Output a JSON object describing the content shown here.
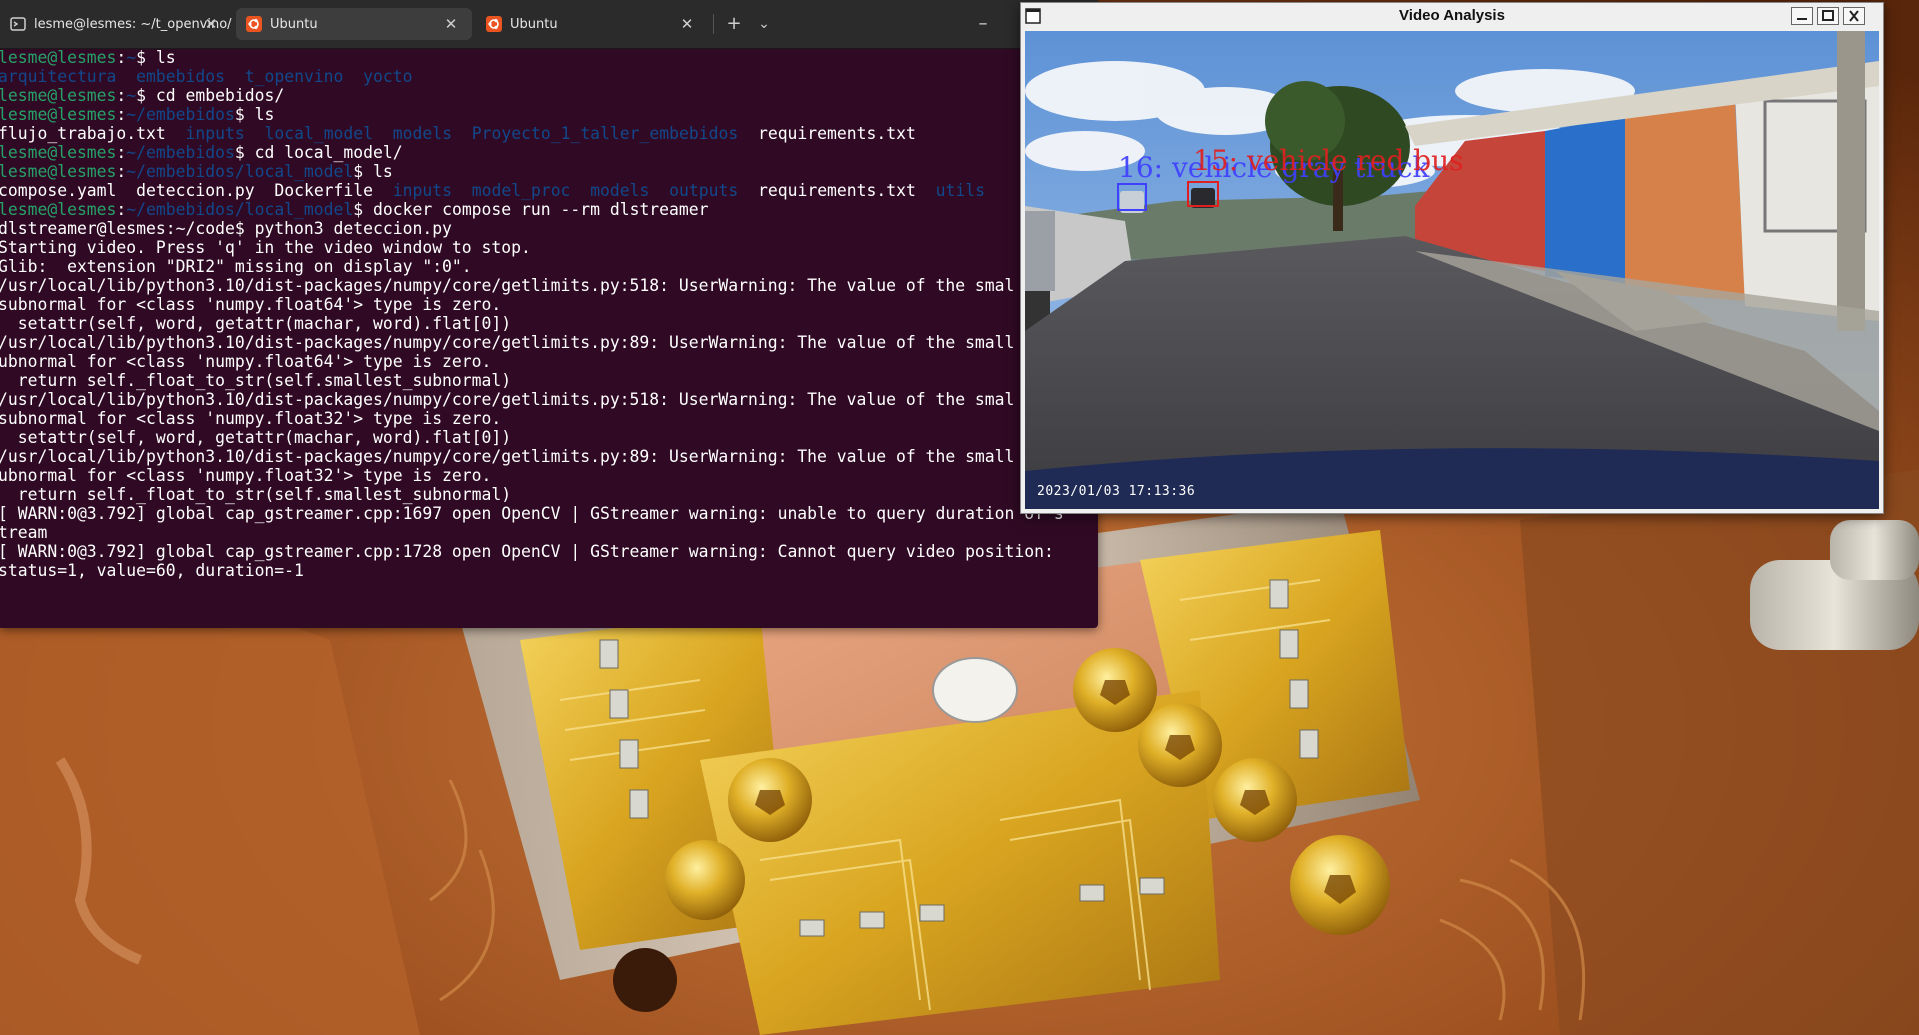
{
  "terminal": {
    "tabs": [
      {
        "title": "lesme@lesmes: ~/t_openvino/",
        "icon": "terminal-icon",
        "active": false
      },
      {
        "title": "Ubuntu",
        "icon": "ubuntu-icon",
        "active": true
      },
      {
        "title": "Ubuntu",
        "icon": "ubuntu-icon",
        "active": false
      }
    ],
    "new_tab_label": "+",
    "tab_menu_label": "⌄",
    "minimize_label": "–",
    "colors": {
      "background": "#300a24",
      "prompt_user": "#26a269",
      "prompt_path": "#12488b"
    },
    "lines": {
      "l1": {
        "user": "lesme@lesmes",
        "path": "~",
        "cmd": "$ ls"
      },
      "l2": {
        "dirs": [
          "arquitectura",
          "embebidos",
          "t_openvino",
          "yocto"
        ]
      },
      "l3": {
        "user": "lesme@lesmes",
        "path": "~",
        "cmd": "$ cd embebidos/"
      },
      "l4": {
        "user": "lesme@lesmes",
        "path": "~/embebidos",
        "cmd": "$ ls"
      },
      "l5": {
        "file1": "flujo_trabajo.txt",
        "dirs": [
          "inputs",
          "local_model",
          "models",
          "Proyecto_1_taller_embebidos"
        ],
        "file2": "requirements.txt"
      },
      "l6": {
        "user": "lesme@lesmes",
        "path": "~/embebidos",
        "cmd": "$ cd local_model/"
      },
      "l7": {
        "user": "lesme@lesmes",
        "path": "~/embebidos/local_model",
        "cmd": "$ ls"
      },
      "l8": {
        "files1": [
          "compose.yaml",
          "deteccion.py",
          "Dockerfile"
        ],
        "dirs": [
          "inputs",
          "model_proc",
          "models",
          "outputs"
        ],
        "file2": "requirements.txt",
        "dir2": "utils"
      },
      "l9": {
        "user": "lesme@lesmes",
        "path": "~/embebidos/local_model",
        "cmd": "$ docker compose run --rm dlstreamer"
      },
      "l10": "dlstreamer@lesmes:~/code$ python3 deteccion.py",
      "l11": "Starting video. Press 'q' in the video window to stop.",
      "l12": "Glib:  extension \"DRI2\" missing on display \":0\".",
      "l13": "/usr/local/lib/python3.10/dist-packages/numpy/core/getlimits.py:518: UserWarning: The value of the smal",
      "l14": "subnormal for <class 'numpy.float64'> type is zero.",
      "l15": "  setattr(self, word, getattr(machar, word).flat[0])",
      "l16": "/usr/local/lib/python3.10/dist-packages/numpy/core/getlimits.py:89: UserWarning: The value of the small",
      "l17": "ubnormal for <class 'numpy.float64'> type is zero.",
      "l18": "  return self._float_to_str(self.smallest_subnormal)",
      "l19": "/usr/local/lib/python3.10/dist-packages/numpy/core/getlimits.py:518: UserWarning: The value of the smal",
      "l20": "subnormal for <class 'numpy.float32'> type is zero.",
      "l21": "  setattr(self, word, getattr(machar, word).flat[0])",
      "l22": "/usr/local/lib/python3.10/dist-packages/numpy/core/getlimits.py:89: UserWarning: The value of the small",
      "l23": "ubnormal for <class 'numpy.float32'> type is zero.",
      "l24": "  return self._float_to_str(self.smallest_subnormal)",
      "l25": "[ WARN:0@3.792] global cap_gstreamer.cpp:1697 open OpenCV | GStreamer warning: unable to query duration of s",
      "l26": "tream",
      "l27": "[ WARN:0@3.792] global cap_gstreamer.cpp:1728 open OpenCV | GStreamer warning: Cannot query video position:",
      "l28": "status=1, value=60, duration=-1"
    }
  },
  "video_window": {
    "title": "Video Analysis",
    "timestamp": "2023/01/03  17:13:36",
    "detections": [
      {
        "label": "16: vehicle gray truck",
        "color": "#4040ff"
      },
      {
        "label": "15: vehicle red bus",
        "color": "#e02020"
      }
    ],
    "controls": [
      "minimize-button",
      "maximize-button",
      "close-button"
    ]
  }
}
